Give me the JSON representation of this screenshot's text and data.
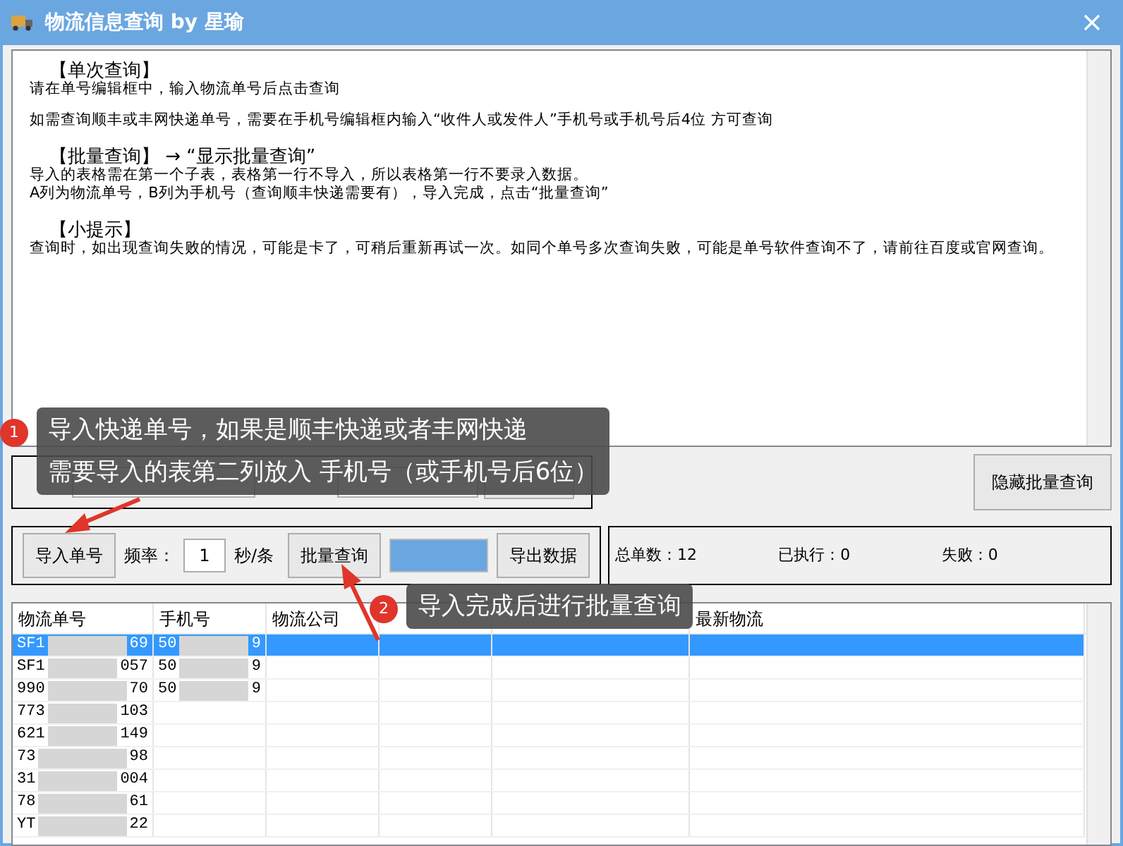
{
  "window": {
    "title": "物流信息查询 by 星瑜"
  },
  "help_text": {
    "sections": [
      {
        "heading": "【单次查询】",
        "paragraphs": [
          [
            "请在单号编辑框中，输入物流单号后点击查询"
          ],
          [
            "如需查询顺丰或丰网快递单号，需要在手机号编辑框内输入“收件人或发件人”手机号或手机号后4位 方可查询"
          ]
        ]
      },
      {
        "heading": "【批量查询】 → “显示批量查询”",
        "paragraphs": [
          [
            "导入的表格需在第一个子表，表格第一行不导入，所以表格第一行不要录入数据。",
            "A列为物流单号，B列为手机号（查询顺丰快递需要有），导入完成，点击“批量查询”"
          ]
        ]
      },
      {
        "heading": "【小提示】",
        "paragraphs": [
          [
            "查询时，如出现查询失败的情况，可能是卡了，可稍后重新再试一次。如同个单号多次查询失败，可能是单号软件查询不了，请前往百度或官网查询。"
          ]
        ]
      }
    ]
  },
  "toggle_button": "隐藏批量查询",
  "batch": {
    "import_button": "导入单号",
    "rate_label": "频率：",
    "rate_value": "1",
    "rate_unit": "秒/条",
    "batch_button": "批量查询",
    "progress": {
      "level": 1
    },
    "export_button": "导出数据"
  },
  "stats": [
    {
      "label": "总单数：",
      "value": "12"
    },
    {
      "label": "已执行：",
      "value": "0"
    },
    {
      "label": "失败：",
      "value": "0"
    }
  ],
  "table": {
    "columns": [
      "物流单号",
      "手机号",
      "物流公司",
      "",
      "",
      "最新物流"
    ],
    "rows": [
      {
        "selected": true,
        "number": [
          "SF1",
          "69"
        ],
        "phone": [
          "50",
          "9"
        ]
      },
      {
        "selected": false,
        "number": [
          "SF1",
          "057"
        ],
        "phone": [
          "50",
          "9"
        ]
      },
      {
        "selected": false,
        "number": [
          "990",
          "70"
        ],
        "phone": [
          "50",
          "9"
        ]
      },
      {
        "selected": false,
        "number": [
          "773",
          "103"
        ],
        "phone": []
      },
      {
        "selected": false,
        "number": [
          "621",
          "149"
        ],
        "phone": []
      },
      {
        "selected": false,
        "number": [
          "73",
          "98"
        ],
        "phone": []
      },
      {
        "selected": false,
        "number": [
          "31",
          "004"
        ],
        "phone": []
      },
      {
        "selected": false,
        "number": [
          "78",
          "61"
        ],
        "phone": []
      },
      {
        "selected": false,
        "number": [
          "YT",
          "22"
        ],
        "phone": []
      }
    ]
  },
  "callouts": [
    {
      "badge": "1",
      "lines": [
        "导入快递单号，如果是顺丰快递或者丰网快递",
        "需要导入的表第二列放入 手机号（或手机号后6位）"
      ]
    },
    {
      "badge": "2",
      "lines": [
        "导入完成后进行批量查询"
      ]
    }
  ]
}
